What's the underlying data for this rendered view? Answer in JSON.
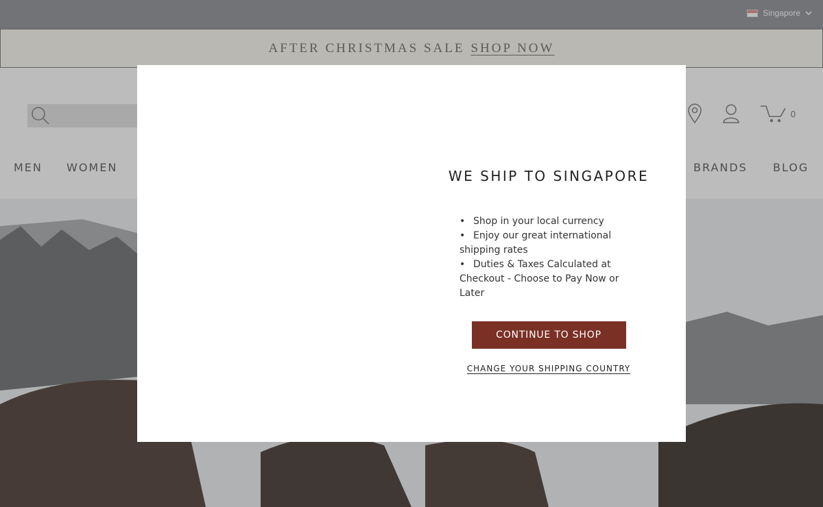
{
  "topbar": {
    "country": "Singapore",
    "flag_colors": [
      "#e4848c",
      "#ffffff"
    ]
  },
  "promo": {
    "text": "AFTER CHRISTMAS SALE",
    "link": "SHOP NOW"
  },
  "header": {
    "search_icon": "search-icon",
    "cart_count": "0",
    "icons": [
      "search-icon",
      "location-pin-icon",
      "account-icon",
      "cart-icon"
    ]
  },
  "nav": {
    "items": [
      "MEN",
      "WOMEN",
      "BRANDS",
      "BLOG"
    ]
  },
  "modal": {
    "title": "WE SHIP TO SINGAPORE",
    "benefits": [
      "Shop in your local currency",
      "Enjoy our great international shipping rates",
      "Duties & Taxes Calculated at Checkout - Choose to Pay Now or Later"
    ],
    "cta": "CONTINUE TO SHOP",
    "change_link": "CHANGE YOUR SHIPPING COUNTRY"
  },
  "colors": {
    "accent": "#7b3026",
    "overlay": "rgba(64,64,64,0.35)",
    "promo_text": "#6e6a66"
  }
}
